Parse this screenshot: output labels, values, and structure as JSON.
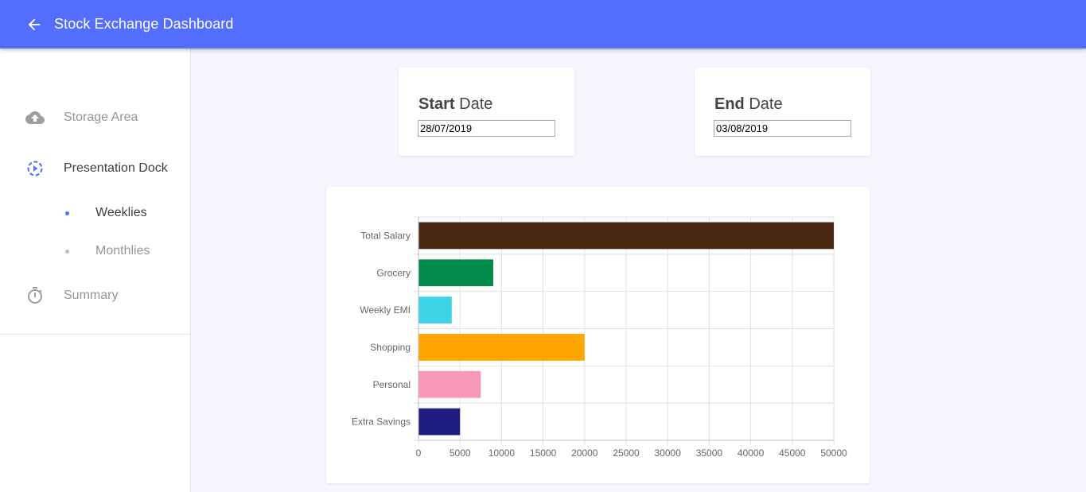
{
  "app": {
    "title": "Stock Exchange Dashboard"
  },
  "icons": {
    "back": "arrow-left-icon"
  },
  "colors": {
    "primary": "#536dfe",
    "background": "#f4f5fd"
  },
  "sidebar": {
    "items": [
      {
        "label": "Storage Area",
        "icon": "cloud-upload-icon",
        "active": false
      },
      {
        "label": "Presentation Dock",
        "icon": "play-circle-icon",
        "active": true
      },
      {
        "label": "Summary",
        "icon": "timer-icon",
        "active": false
      }
    ],
    "subitems": [
      {
        "label": "Weeklies",
        "active": true
      },
      {
        "label": "Monthlies",
        "active": false
      }
    ]
  },
  "start_date": {
    "bold": "Start",
    "rest": " Date",
    "value": "28/07/2019"
  },
  "end_date": {
    "bold": "End",
    "rest": " Date",
    "value": "03/08/2019"
  },
  "chart_data": {
    "type": "bar",
    "orientation": "horizontal",
    "categories": [
      "Total Salary",
      "Grocery",
      "Weekly EMI",
      "Shopping",
      "Personal",
      "Extra Savings"
    ],
    "values": [
      50000,
      9000,
      4000,
      20000,
      7500,
      5000
    ],
    "colors": [
      "#4b2811",
      "#008a4a",
      "#3dd3e6",
      "#ffa600",
      "#f797b9",
      "#1f1d80"
    ],
    "xlim": [
      0,
      50000
    ],
    "xticks": [
      "0",
      "5000",
      "10000",
      "15000",
      "20000",
      "25000",
      "30000",
      "35000",
      "40000",
      "45000",
      "50000"
    ],
    "grid": true,
    "legend": "none"
  }
}
